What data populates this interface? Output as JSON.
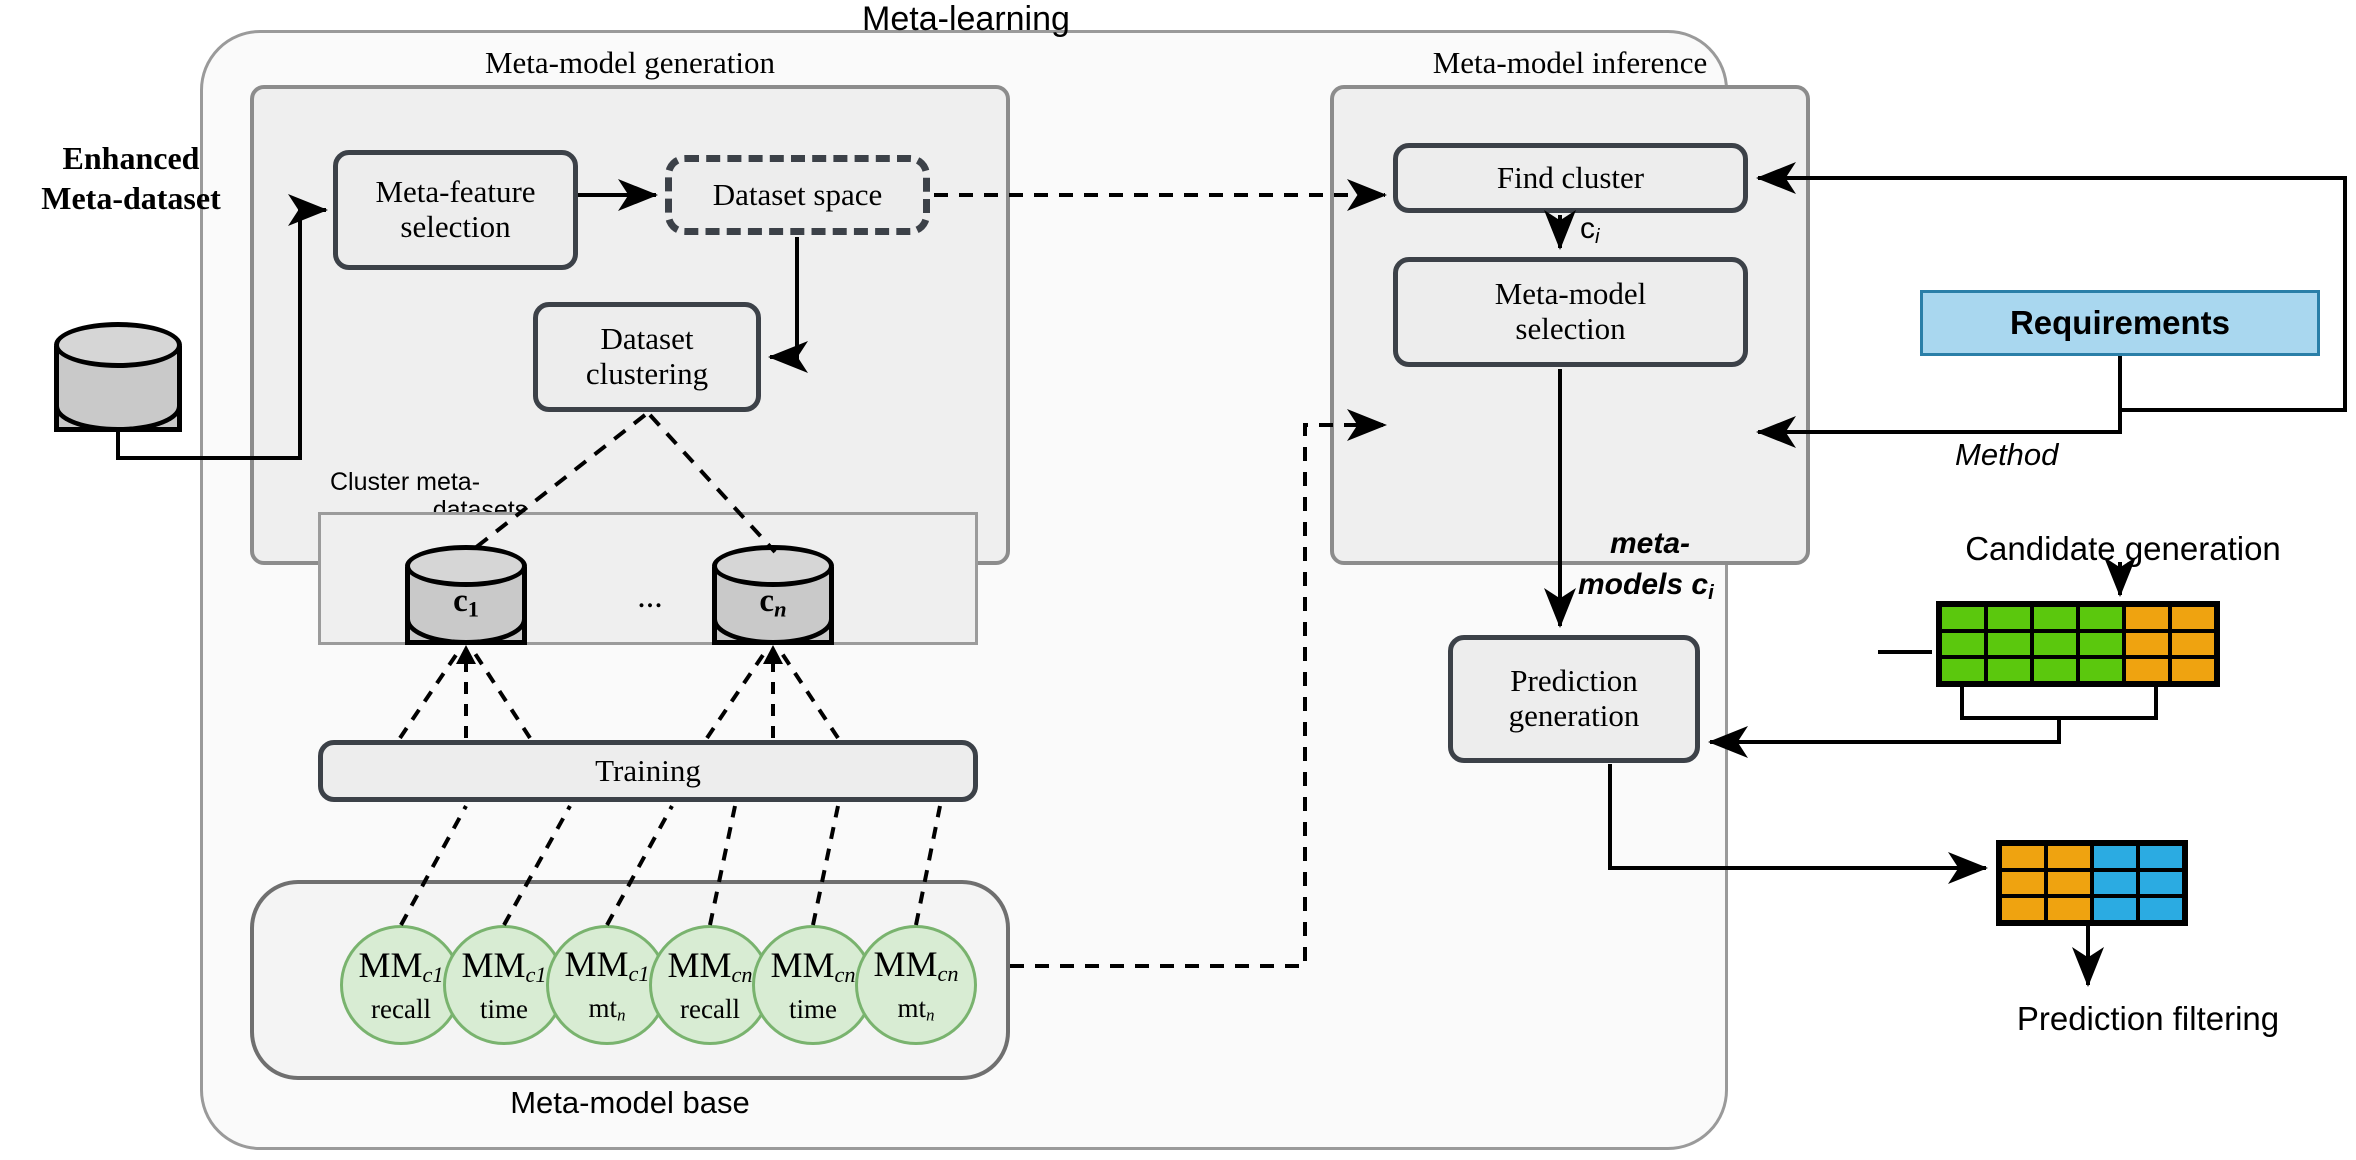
{
  "title": "Meta-learning",
  "panels": {
    "generation": "Meta-model generation",
    "inference": "Meta-model inference"
  },
  "source": {
    "label_line1": "Enhanced",
    "label_line2": "Meta-dataset"
  },
  "generation_boxes": {
    "meta_feature_selection": "Meta-feature\nselection",
    "dataset_space": "Dataset space",
    "dataset_clustering": "Dataset\nclustering",
    "training": "Training"
  },
  "cluster_section": {
    "caption_line1": "Cluster meta-",
    "caption_line2": "datasets",
    "cylinders": [
      {
        "base": "c",
        "sub": "1"
      },
      {
        "base": "c",
        "sub": "n"
      }
    ],
    "ellipsis": "..."
  },
  "meta_model_base": {
    "caption": "Meta-model base",
    "ellipsis": "...",
    "models": [
      {
        "base": "MM",
        "sub": "c1",
        "metric": "recall"
      },
      {
        "base": "MM",
        "sub": "c1",
        "metric": "time"
      },
      {
        "base": "MM",
        "sub": "c1",
        "metric": "mt",
        "metric_sub": "n"
      },
      {
        "base": "MM",
        "sub": "cn",
        "metric": "recall"
      },
      {
        "base": "MM",
        "sub": "cn",
        "metric": "time"
      },
      {
        "base": "MM",
        "sub": "cn",
        "metric": "mt",
        "metric_sub": "n"
      }
    ]
  },
  "inference_boxes": {
    "find_cluster": "Find cluster",
    "meta_model_selection": "Meta-model\nselection",
    "prediction_generation": "Prediction\ngeneration"
  },
  "edge_labels": {
    "cluster_id": {
      "base": "c",
      "sub": "i"
    },
    "meta_models_line1": "meta-",
    "meta_models_line2_base": "models c",
    "meta_models_line2_sub": "i",
    "method": "Method"
  },
  "right_side": {
    "requirements": "Requirements",
    "candidate_generation": "Candidate generation",
    "prediction_filtering": "Prediction filtering"
  },
  "colors": {
    "green": "#5bc80d",
    "orange": "#efa310",
    "blue": "#2babe2",
    "requirements_fill": "#a9d7ef",
    "requirements_stroke": "#2a7fa8",
    "box_stroke": "#3c4148",
    "panel_stroke": "#8c8c8c",
    "outer_stroke": "#9a9a9a",
    "mm_fill": "#d8ecd3",
    "mm_stroke": "#79b36e",
    "cylinder_fill": "#c9c9c9"
  },
  "matrices": {
    "candidate": {
      "rows": 3,
      "cols": 6,
      "col_colors": [
        "green",
        "green",
        "green",
        "green",
        "orange",
        "orange"
      ]
    },
    "prediction": {
      "rows": 3,
      "cols": 4,
      "col_colors": [
        "orange",
        "orange",
        "blue",
        "blue"
      ]
    }
  }
}
